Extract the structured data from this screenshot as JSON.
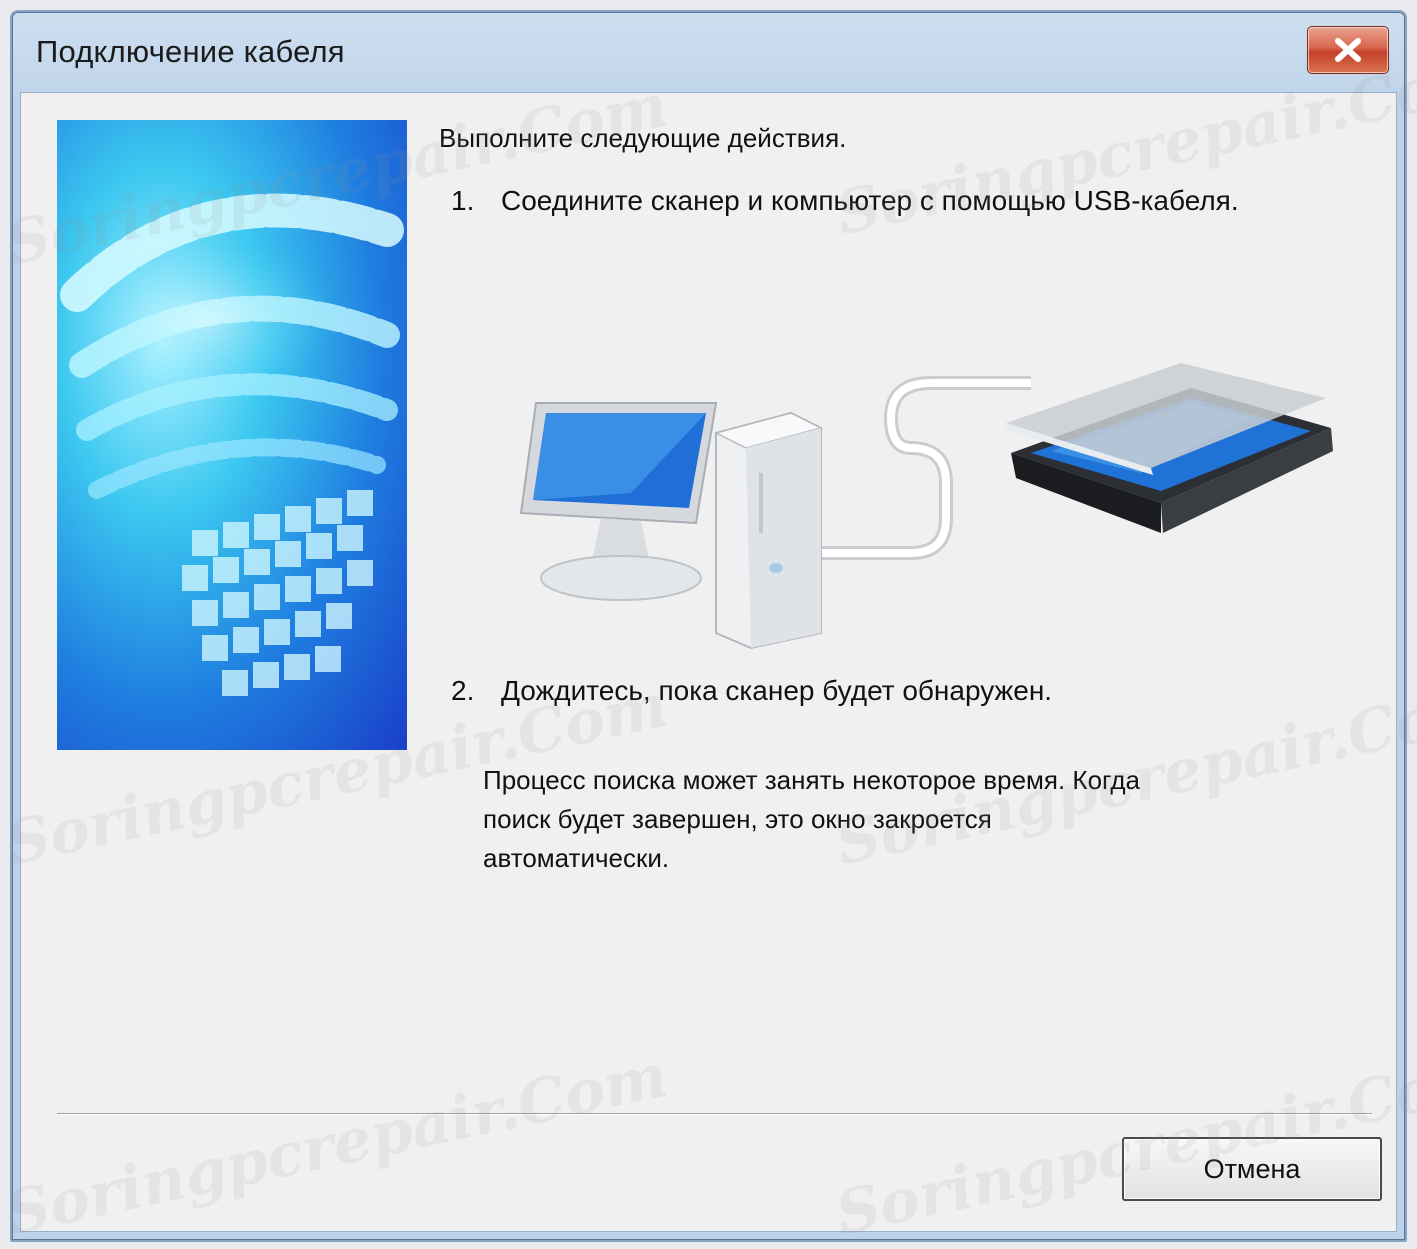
{
  "window": {
    "title": "Подключение кабеля",
    "close_icon": "close-icon"
  },
  "content": {
    "heading": "Выполните следующие действия.",
    "steps": [
      {
        "number": "1.",
        "text": "Соедините сканер и компьютер с помощью USB-кабеля."
      },
      {
        "number": "2.",
        "text": "Дождитесь, пока сканер будет обнаружен."
      }
    ],
    "description_lines": [
      "Процесс поиска может занять некоторое время. Когда",
      "поиск будет завершен, это окно закроется",
      "автоматически."
    ]
  },
  "footer": {
    "cancel_label": "Отмена"
  },
  "watermark": "Soringpcrepair.Com",
  "colors": {
    "dialog_background": "#f0f0f0",
    "title_bar": "#bed3ea",
    "close_button": "#c5402a",
    "banner_blue": "#1f7fe0"
  }
}
